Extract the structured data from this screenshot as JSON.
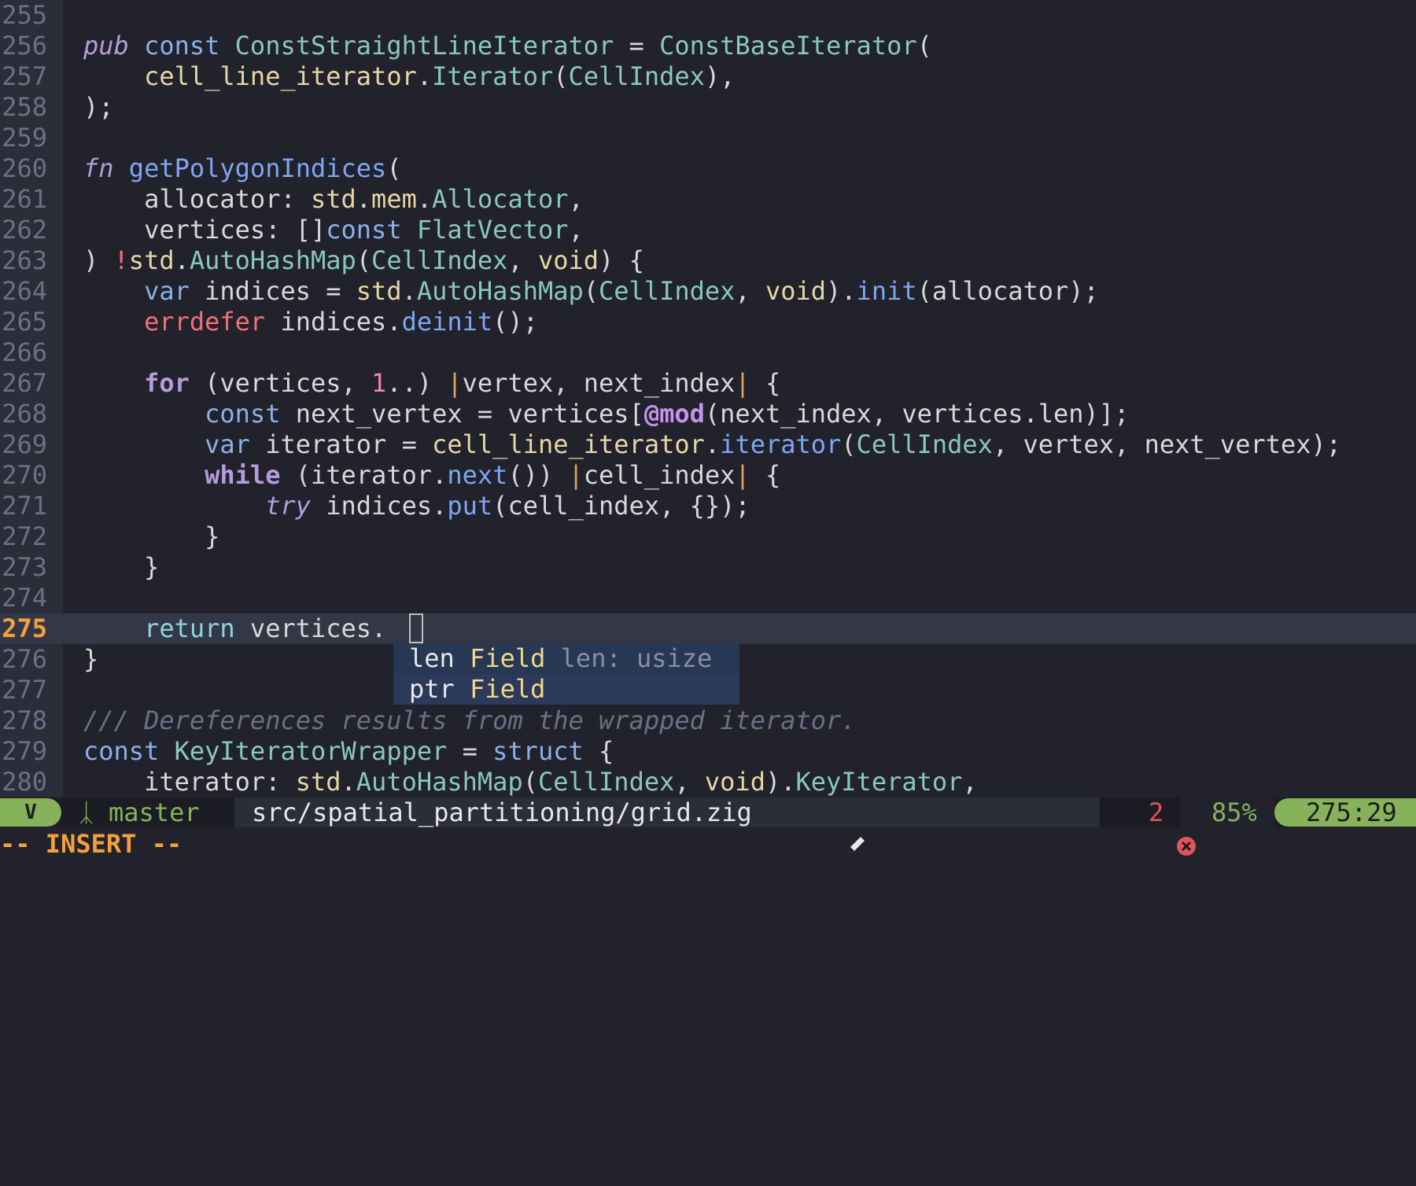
{
  "editor": {
    "lines": [
      {
        "number": "255",
        "tokens": []
      },
      {
        "number": "256",
        "tokens": [
          {
            "t": "pub",
            "c": "t-kwi"
          },
          {
            "t": " "
          },
          {
            "t": "const",
            "c": "t-kw"
          },
          {
            "t": " "
          },
          {
            "t": "ConstStraightLineIterator",
            "c": "t-type"
          },
          {
            "t": " = "
          },
          {
            "t": "ConstBaseIterator",
            "c": "t-type"
          },
          {
            "t": "("
          }
        ]
      },
      {
        "number": "257",
        "tokens": [
          {
            "t": "    "
          },
          {
            "t": "cell_line_iterator",
            "c": "t-mem"
          },
          {
            "t": "."
          },
          {
            "t": "Iterator",
            "c": "t-type"
          },
          {
            "t": "("
          },
          {
            "t": "CellIndex",
            "c": "t-type"
          },
          {
            "t": "),"
          }
        ]
      },
      {
        "number": "258",
        "tokens": [
          {
            "t": ");"
          }
        ]
      },
      {
        "number": "259",
        "tokens": []
      },
      {
        "number": "260",
        "tokens": [
          {
            "t": "fn",
            "c": "t-kwi"
          },
          {
            "t": " "
          },
          {
            "t": "getPolygonIndices",
            "c": "t-fn"
          },
          {
            "t": "("
          }
        ]
      },
      {
        "number": "261",
        "tokens": [
          {
            "t": "    allocator: "
          },
          {
            "t": "std",
            "c": "t-mem"
          },
          {
            "t": "."
          },
          {
            "t": "mem",
            "c": "t-mem"
          },
          {
            "t": "."
          },
          {
            "t": "Allocator",
            "c": "t-type"
          },
          {
            "t": ","
          }
        ]
      },
      {
        "number": "262",
        "tokens": [
          {
            "t": "    vertices: []"
          },
          {
            "t": "const",
            "c": "t-kw"
          },
          {
            "t": " "
          },
          {
            "t": "FlatVector",
            "c": "t-type"
          },
          {
            "t": ","
          }
        ]
      },
      {
        "number": "263",
        "tokens": [
          {
            "t": ") "
          },
          {
            "t": "!",
            "c": "t-err"
          },
          {
            "t": "std",
            "c": "t-mem"
          },
          {
            "t": "."
          },
          {
            "t": "AutoHashMap",
            "c": "t-type"
          },
          {
            "t": "("
          },
          {
            "t": "CellIndex",
            "c": "t-type"
          },
          {
            "t": ", "
          },
          {
            "t": "void",
            "c": "t-mem"
          },
          {
            "t": ") {"
          }
        ]
      },
      {
        "number": "264",
        "tokens": [
          {
            "t": "    "
          },
          {
            "t": "var",
            "c": "t-kw"
          },
          {
            "t": " indices = "
          },
          {
            "t": "std",
            "c": "t-mem"
          },
          {
            "t": "."
          },
          {
            "t": "AutoHashMap",
            "c": "t-type"
          },
          {
            "t": "("
          },
          {
            "t": "CellIndex",
            "c": "t-type"
          },
          {
            "t": ", "
          },
          {
            "t": "void",
            "c": "t-mem"
          },
          {
            "t": ")."
          },
          {
            "t": "init",
            "c": "t-fn"
          },
          {
            "t": "(allocator);"
          }
        ]
      },
      {
        "number": "265",
        "tokens": [
          {
            "t": "    "
          },
          {
            "t": "errdefer",
            "c": "t-err"
          },
          {
            "t": " indices."
          },
          {
            "t": "deinit",
            "c": "t-fn"
          },
          {
            "t": "();"
          }
        ]
      },
      {
        "number": "266",
        "tokens": []
      },
      {
        "number": "267",
        "tokens": [
          {
            "t": "    "
          },
          {
            "t": "for",
            "c": "t-kwb"
          },
          {
            "t": " (vertices, "
          },
          {
            "t": "1",
            "c": "t-num"
          },
          {
            "t": "..) "
          },
          {
            "t": "|",
            "c": "t-pipe"
          },
          {
            "t": "vertex, next_index"
          },
          {
            "t": "|",
            "c": "t-pipe"
          },
          {
            "t": " {"
          }
        ]
      },
      {
        "number": "268",
        "tokens": [
          {
            "t": "        "
          },
          {
            "t": "const",
            "c": "t-kw"
          },
          {
            "t": " next_vertex = vertices["
          },
          {
            "t": "@mod",
            "c": "t-bi"
          },
          {
            "t": "(next_index, vertices.len)];"
          }
        ]
      },
      {
        "number": "269",
        "tokens": [
          {
            "t": "        "
          },
          {
            "t": "var",
            "c": "t-kw"
          },
          {
            "t": " iterator = "
          },
          {
            "t": "cell_line_iterator",
            "c": "t-mem"
          },
          {
            "t": "."
          },
          {
            "t": "iterator",
            "c": "t-fn"
          },
          {
            "t": "("
          },
          {
            "t": "CellIndex",
            "c": "t-type"
          },
          {
            "t": ", vertex, next_vertex);"
          }
        ]
      },
      {
        "number": "270",
        "tokens": [
          {
            "t": "        "
          },
          {
            "t": "while",
            "c": "t-kwb"
          },
          {
            "t": " (iterator."
          },
          {
            "t": "next",
            "c": "t-fn"
          },
          {
            "t": "()) "
          },
          {
            "t": "|",
            "c": "t-pipe"
          },
          {
            "t": "cell_index"
          },
          {
            "t": "|",
            "c": "t-pipe"
          },
          {
            "t": " {"
          }
        ]
      },
      {
        "number": "271",
        "tokens": [
          {
            "t": "            "
          },
          {
            "t": "try",
            "c": "t-kwi"
          },
          {
            "t": " indices."
          },
          {
            "t": "put",
            "c": "t-fn"
          },
          {
            "t": "(cell_index, {});"
          }
        ]
      },
      {
        "number": "272",
        "tokens": [
          {
            "t": "        }"
          }
        ]
      },
      {
        "number": "273",
        "tokens": [
          {
            "t": "    }"
          }
        ]
      },
      {
        "number": "274",
        "tokens": []
      },
      {
        "number": "275",
        "current": true,
        "tokens": [
          {
            "t": "    "
          },
          {
            "t": "return",
            "c": "t-ret"
          },
          {
            "t": " vertices."
          }
        ]
      },
      {
        "number": "276",
        "tokens": [
          {
            "t": "}"
          }
        ]
      },
      {
        "number": "277",
        "tokens": []
      },
      {
        "number": "278",
        "tokens": [
          {
            "t": "/// Dereferences results from the wrapped iterator.",
            "c": "t-cmt"
          }
        ]
      },
      {
        "number": "279",
        "tokens": [
          {
            "t": "const",
            "c": "t-kw"
          },
          {
            "t": " "
          },
          {
            "t": "KeyIteratorWrapper",
            "c": "t-type"
          },
          {
            "t": " = "
          },
          {
            "t": "struct",
            "c": "t-kw"
          },
          {
            "t": " {"
          }
        ]
      },
      {
        "number": "280",
        "tokens": [
          {
            "t": "    iterator: "
          },
          {
            "t": "std",
            "c": "t-mem"
          },
          {
            "t": "."
          },
          {
            "t": "AutoHashMap",
            "c": "t-type"
          },
          {
            "t": "("
          },
          {
            "t": "CellIndex",
            "c": "t-type"
          },
          {
            "t": ", "
          },
          {
            "t": "void",
            "c": "t-mem"
          },
          {
            "t": ")."
          },
          {
            "t": "KeyIterator",
            "c": "t-type"
          },
          {
            "t": ","
          }
        ]
      }
    ]
  },
  "completion": {
    "items": [
      {
        "word": "len",
        "kind": "Field",
        "detail": "len: usize",
        "selected": true
      },
      {
        "word": "ptr",
        "kind": "Field",
        "detail": "",
        "selected": false
      }
    ]
  },
  "statusbar": {
    "vim_badge": "V",
    "branch_icon": "branch-icon",
    "branch": "master",
    "filepath": "src/spatial_partitioning/grid.zig",
    "modified_icon": "pencil-icon",
    "error_icon": "error-circle-icon",
    "error_count": "2",
    "percent": "85%",
    "position": "275:29"
  },
  "mode": "-- INSERT --",
  "colors": {
    "background": "#21222c",
    "gutter": "#2b2d39",
    "current_line": "#343746",
    "accent_green": "#86b35a",
    "accent_orange": "#f4a13a",
    "error_red": "#e05555"
  }
}
